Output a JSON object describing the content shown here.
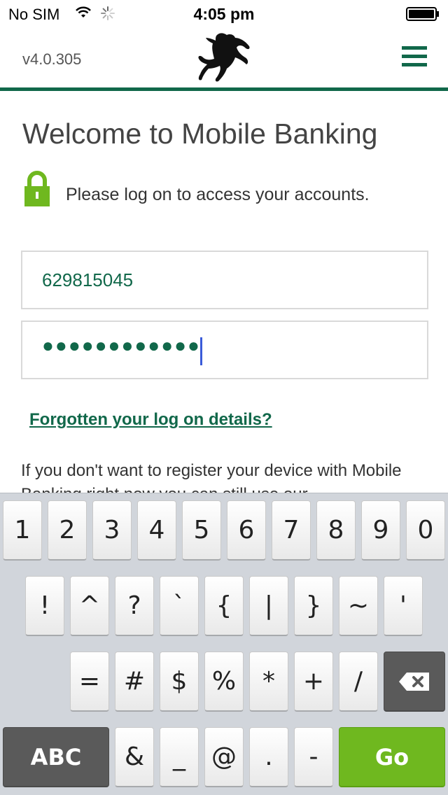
{
  "status_bar": {
    "carrier": "No SIM",
    "time": "4:05 pm"
  },
  "header": {
    "version": "v4.0.305",
    "brand_color": "#11684a"
  },
  "main": {
    "title": "Welcome to Mobile Banking",
    "prompt": "Please log on to access your accounts.",
    "user_id_value": "629815045",
    "password_masked": "●●●●●●●●●●●●",
    "forgot_link": "Forgotten your log on details?",
    "register_text": "If you don't want to register your device with Mobile Banking right now you can still use our"
  },
  "keyboard": {
    "row1": [
      "1",
      "2",
      "3",
      "4",
      "5",
      "6",
      "7",
      "8",
      "9",
      "0"
    ],
    "row2": [
      "!",
      "^",
      "?",
      "`",
      "{",
      "|",
      "}",
      "~",
      "'"
    ],
    "row3": [
      "=",
      "#",
      "$",
      "%",
      "*",
      "+",
      "/"
    ],
    "row4": [
      "&",
      "_",
      "@",
      ".",
      "-"
    ],
    "abc_label": "ABC",
    "go_label": "Go",
    "go_color": "#6fb81f"
  }
}
